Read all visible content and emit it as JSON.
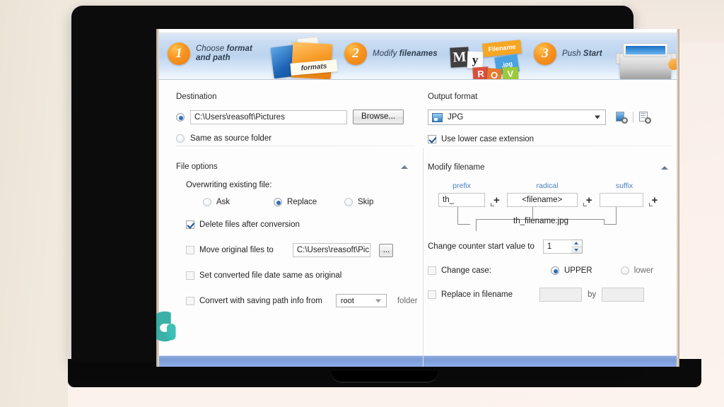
{
  "banner": {
    "steps": [
      {
        "num": "1",
        "line1": "Choose format",
        "line2": "and path"
      },
      {
        "num": "2",
        "line1": "Modify",
        "line2": "filenames"
      },
      {
        "num": "3",
        "line1": "Push",
        "line2": "Start"
      }
    ],
    "art": {
      "folder_label": "formats",
      "tiles": [
        "M",
        "y",
        "Filename",
        ".jpg",
        "R",
        "O",
        "V"
      ]
    }
  },
  "destination": {
    "title": "Destination",
    "path_value": "C:\\Users\\reasoft\\Pictures",
    "path_selected": true,
    "browse_label": "Browse...",
    "same_as_source_label": "Same as source folder",
    "same_as_source_selected": false
  },
  "output_format": {
    "title": "Output format",
    "selected": "JPG",
    "format_icon": "image-format-icon",
    "settings_icon": "image-settings-icon",
    "doc_settings_icon": "document-settings-icon",
    "lowercase_label": "Use lower case extension",
    "lowercase_checked": true
  },
  "file_options": {
    "title": "File options",
    "overwrite_label": "Overwriting existing file:",
    "overwrite_options": [
      {
        "label": "Ask",
        "selected": false
      },
      {
        "label": "Replace",
        "selected": true
      },
      {
        "label": "Skip",
        "selected": false
      }
    ],
    "delete_after_label": "Delete files after conversion",
    "delete_after_checked": true,
    "move_original_label": "Move original files to",
    "move_original_checked": false,
    "move_original_path": "C:\\Users\\reasoft\\Pic",
    "browse_ellipsis": "...",
    "set_date_label": "Set converted file date same as original",
    "set_date_checked": false,
    "save_path_label": "Convert with saving path info from",
    "save_path_checked": false,
    "save_path_value": "root",
    "save_path_suffix": "folder"
  },
  "modify_filename": {
    "title": "Modify filename",
    "headers": {
      "prefix": "prefix",
      "radical": "radical",
      "suffix": "suffix"
    },
    "prefix_value": "th_",
    "radical_value": "<filename>",
    "suffix_value": "",
    "plus": "+",
    "preview": "th_filename.jpg",
    "counter_label": "Change counter start value to",
    "counter_value": "1",
    "change_case_label": "Change case:",
    "change_case_checked": false,
    "case_upper_label": "UPPER",
    "case_upper_selected": true,
    "case_lower_label": "lower",
    "case_lower_selected": false,
    "replace_label": "Replace in filename",
    "replace_checked": false,
    "replace_from": "",
    "replace_by_label": "by",
    "replace_to": ""
  },
  "colors": {
    "accent_orange": "#f79321",
    "accent_blue": "#4a7fc1",
    "banner_blue": "#bdd4ee",
    "statusbar_blue": "#8ba7dd",
    "watermark_teal": "#2aa9a0"
  }
}
